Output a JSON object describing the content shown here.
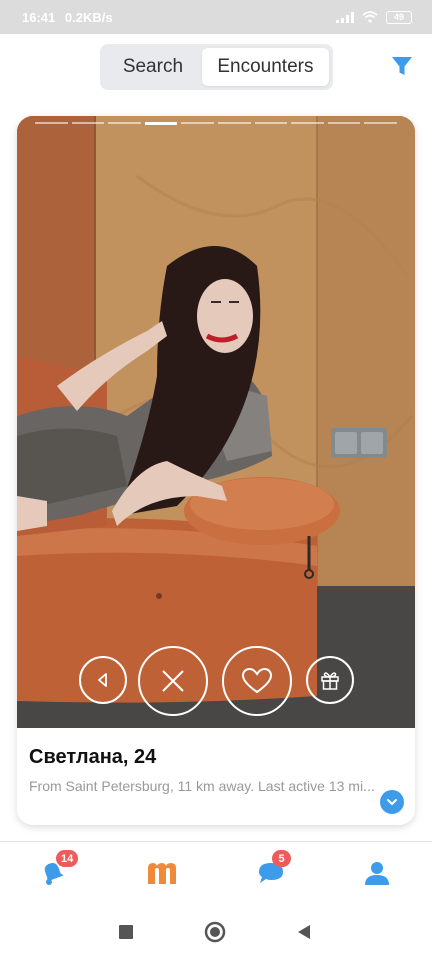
{
  "status_bar": {
    "time": "16:41",
    "net_speed": "0.2KB/s",
    "battery": "49"
  },
  "header": {
    "tabs": [
      {
        "label": "Search",
        "active": false
      },
      {
        "label": "Encounters",
        "active": true
      }
    ],
    "filter_icon": "filter-funnel-icon"
  },
  "card": {
    "photo_count": 10,
    "active_photo_index": 3,
    "name_age": "Светлана, 24",
    "details": "From Saint Petersburg, 11 km away. Last active 13 mi...",
    "actions": [
      "back-arrow-icon",
      "dislike-x-icon",
      "like-heart-icon",
      "gift-icon"
    ],
    "expand_icon": "chevron-down-icon"
  },
  "bottom_nav": {
    "notifications_badge": "14",
    "messages_badge": "5",
    "items": [
      "notifications-bell-icon",
      "app-logo-icon",
      "chat-bubble-icon",
      "profile-person-icon"
    ]
  },
  "colors": {
    "accent": "#3d9be9",
    "brand_orange": "#f08a3b",
    "badge_red": "#ef5b5b"
  },
  "system_nav": [
    "recents-square-icon",
    "home-circle-icon",
    "back-triangle-icon"
  ]
}
